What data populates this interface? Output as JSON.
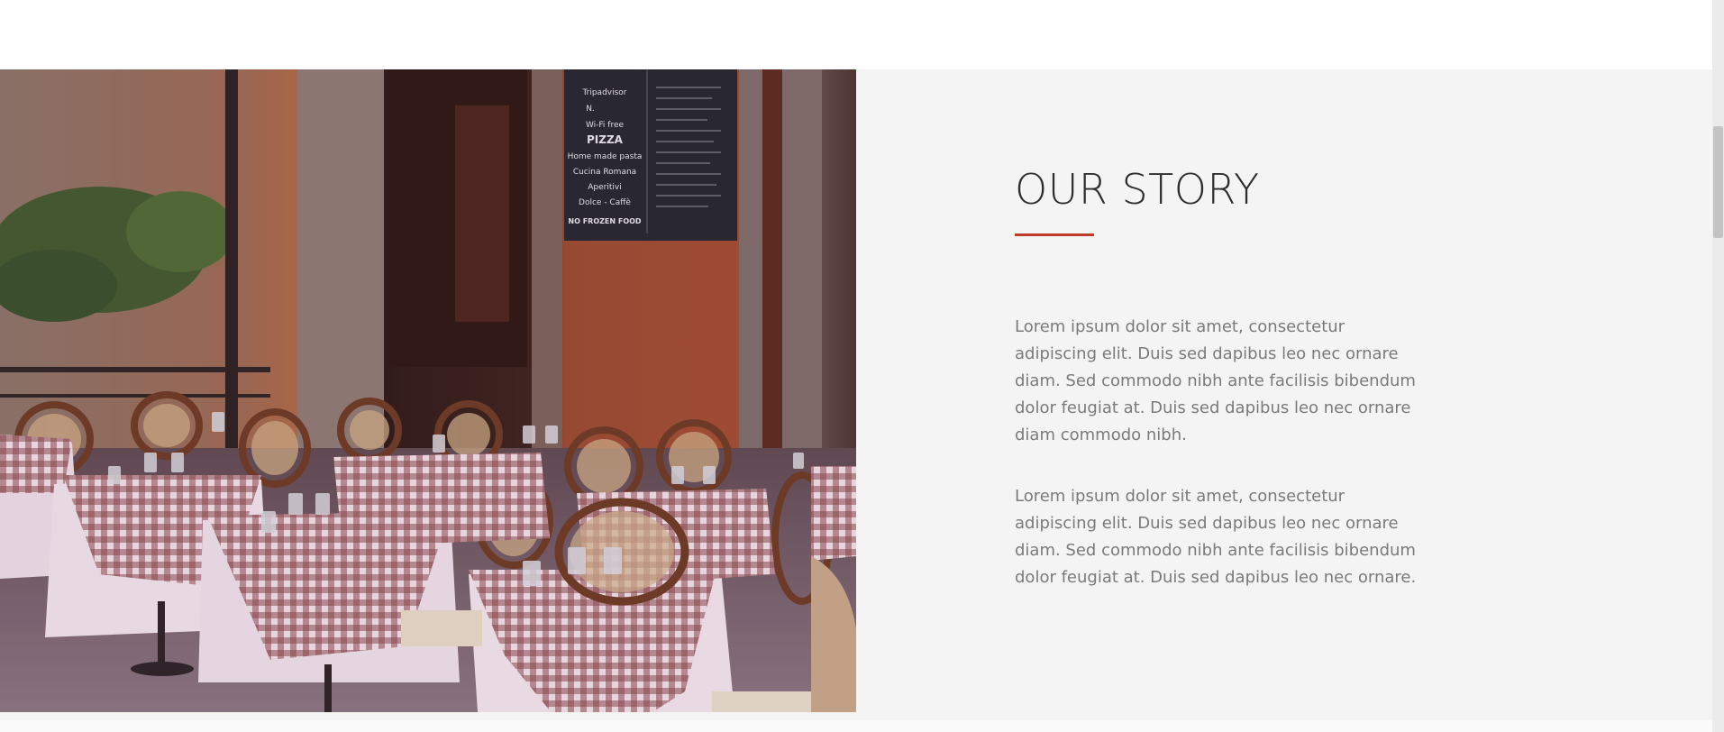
{
  "story": {
    "title": "OUR STORY",
    "paragraph_1": "Lorem ipsum dolor sit amet, consectetur adipiscing elit. Duis sed dapibus leo nec ornare diam. Sed commodo nibh ante facilisis bibendum dolor feugiat at. Duis sed dapibus leo nec ornare diam commodo nibh.",
    "paragraph_2": "Lorem ipsum dolor sit amet, consectetur adipiscing elit. Duis sed dapibus leo nec ornare diam. Sed commodo nibh ante facilisis bibendum dolor feugiat at. Duis sed dapibus leo nec ornare.",
    "accent_color": "#c0392b"
  },
  "photo": {
    "menu_board_lines": [
      "Tripadvisor",
      "N.",
      "Wi-Fi free",
      "PIZZA",
      "Home made pasta",
      "Cucina Romana",
      "Aperitivi",
      "Dolce - Caffè",
      "NO FROZEN FOOD"
    ]
  },
  "colors": {
    "section_background": "#f4f4f4",
    "title": "#2d2d2d",
    "body_text": "#7a7a7a"
  }
}
